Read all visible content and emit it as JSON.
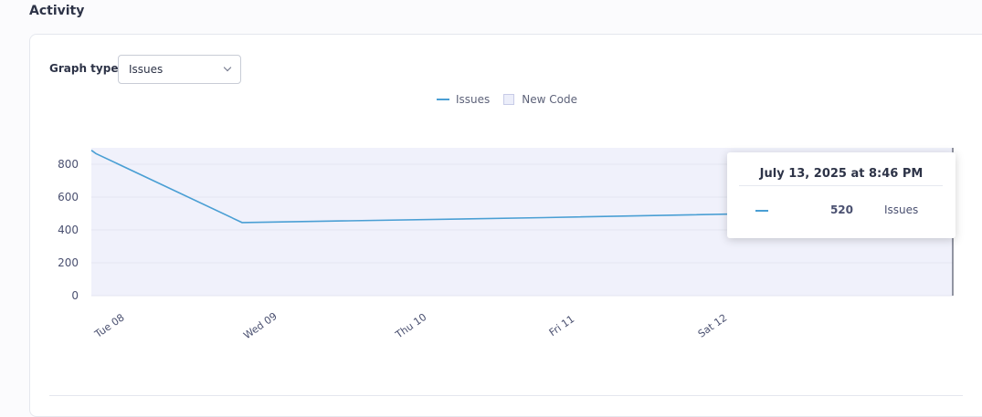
{
  "section": {
    "title": "Activity"
  },
  "controls": {
    "graph_type_label": "Graph type",
    "graph_type_value": "Issues"
  },
  "legend": {
    "series_label": "Issues",
    "new_code_label": "New Code"
  },
  "tooltip": {
    "title": "July 13, 2025 at 8:46 PM",
    "value": "520",
    "series": "Issues"
  },
  "colors": {
    "series": "#4a9fd4",
    "new_code_area": "#f0f1fb",
    "grid": "#e3e5f0",
    "axis_text": "#4a5070"
  },
  "chart_data": {
    "type": "line",
    "x_tick_labels": [
      "Tue 08",
      "Wed 09",
      "Thu 10",
      "Fri 11",
      "Sat 12"
    ],
    "ylim": [
      0,
      900
    ],
    "y_ticks": [
      0,
      200,
      400,
      600,
      800
    ],
    "series": [
      {
        "name": "Issues",
        "points": [
          {
            "day": 0.0,
            "y": 885
          },
          {
            "day": 0.03,
            "y": 865
          },
          {
            "day": 1.0,
            "y": 445
          },
          {
            "day": 3.0,
            "y": 475
          },
          {
            "day": 5.0,
            "y": 510
          },
          {
            "day": 5.6,
            "y": 520
          }
        ]
      }
    ],
    "new_code_period": true,
    "grid": true
  }
}
